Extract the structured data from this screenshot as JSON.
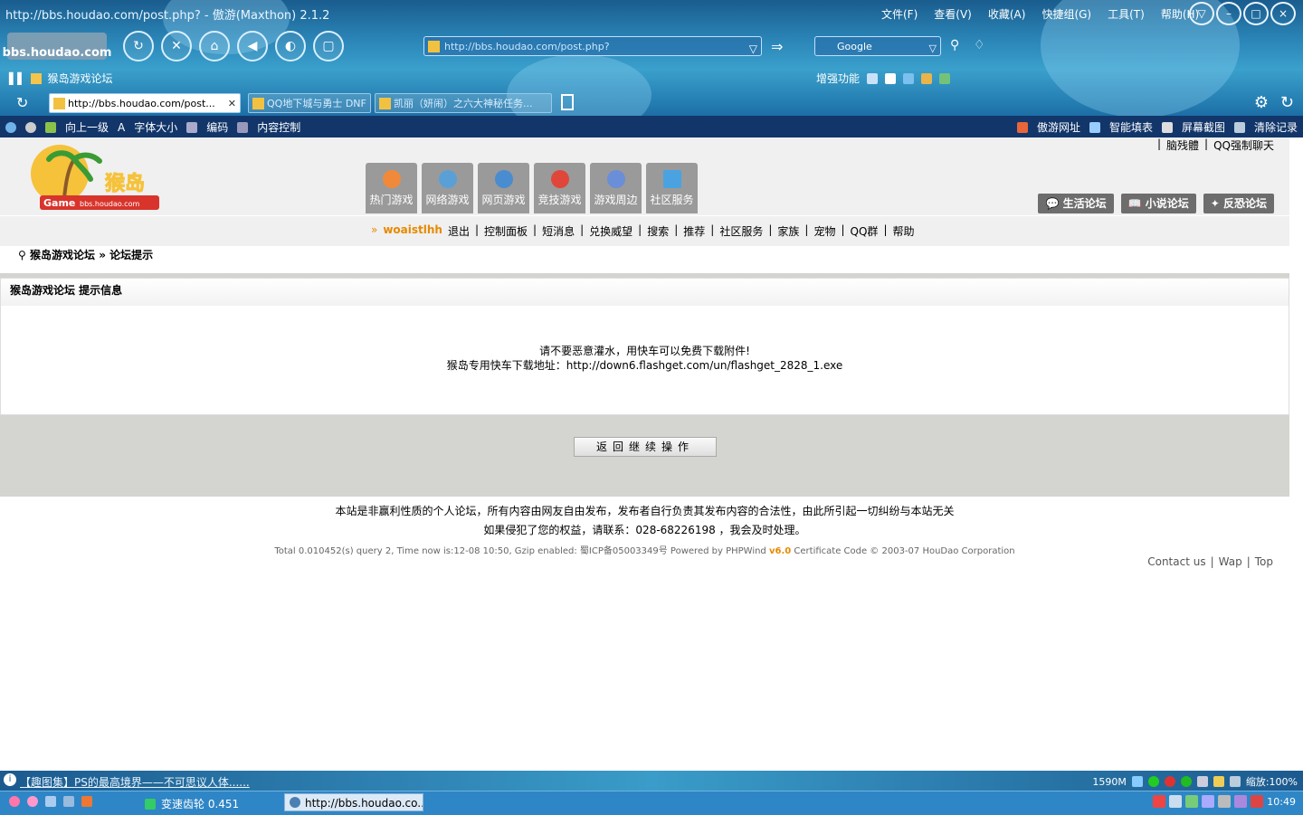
{
  "browser": {
    "title": "http://bbs.houdao.com/post.php? - 傲游(Maxthon) 2.1.2",
    "menu": [
      "文件(F)",
      "查看(V)",
      "收藏(A)",
      "快捷组(G)",
      "工具(T)",
      "帮助(H)"
    ],
    "logo_text": "bbs.houdao.com",
    "address": "http://bbs.houdao.com/post.php?",
    "search_engine": "Google",
    "favorite_link": "猴岛游戏论坛",
    "enhance_label": "增强功能",
    "tabs": [
      {
        "label": "http://bbs.houdao.com/post...",
        "active": true
      },
      {
        "label": "QQ地下城与勇士 DNF",
        "active": false
      },
      {
        "label": "凯丽（妍闹）之六大神秘任务...",
        "active": false
      }
    ],
    "toolbar_left": [
      "向上一级",
      "字体大小",
      "编码",
      "内容控制"
    ],
    "toolbar_right": [
      "傲游网址",
      "智能填表",
      "屏幕截图",
      "清除记录"
    ]
  },
  "site": {
    "top_links": [
      "脑残體",
      "QQ强制聊天"
    ],
    "logo_brand": "猴岛",
    "logo_sub": "Game bbs.houdao.com",
    "nav_tabs": [
      "热门游戏",
      "网络游戏",
      "网页游戏",
      "竞技游戏",
      "游戏周边",
      "社区服务"
    ],
    "forum_buttons": [
      "生活论坛",
      "小说论坛",
      "反恐论坛"
    ],
    "username": "woaistlhh",
    "subnav": [
      "退出",
      "控制面板",
      "短消息",
      "兑换威望",
      "搜索",
      "推荐",
      "社区服务",
      "家族",
      "宠物",
      "QQ群",
      "帮助"
    ],
    "breadcrumb": [
      "猴岛游戏论坛",
      "论坛提示"
    ]
  },
  "message": {
    "header": "猴岛游戏论坛  提示信息",
    "line1": "请不要恶意灌水，用快车可以免费下载附件!",
    "line2": "猴岛专用快车下载地址：http://down6.flashget.com/un/flashget_2828_1.exe",
    "button": "返回继续操作"
  },
  "footer": {
    "line1": "本站是非赢利性质的个人论坛，所有内容由网友自由发布，发布者自行负责其发布内容的合法性，由此所引起一切纠纷与本站无关",
    "line2": "如果侵犯了您的权益，请联系：028-68226198 ，我会及时处理。",
    "line3a": "Total 0.010452(s) query 2, Time now is:12-08 10:50, Gzip enabled: 蜀ICP备05003349号   Powered by PHPWind",
    "version": "v6.0",
    "line3b": "Certificate Code © 2003-07 HouDao Corporation",
    "links": [
      "Contact us",
      "Wap",
      "Top"
    ]
  },
  "status": {
    "news": "【趣图集】PS的最高境界——不可思议人体......",
    "memory": "1590M",
    "zoom": "缩放:100%"
  },
  "taskbar": {
    "task1": "变速齿轮 0.451",
    "task2": "http://bbs.houdao.co...",
    "clock": "10:49"
  }
}
